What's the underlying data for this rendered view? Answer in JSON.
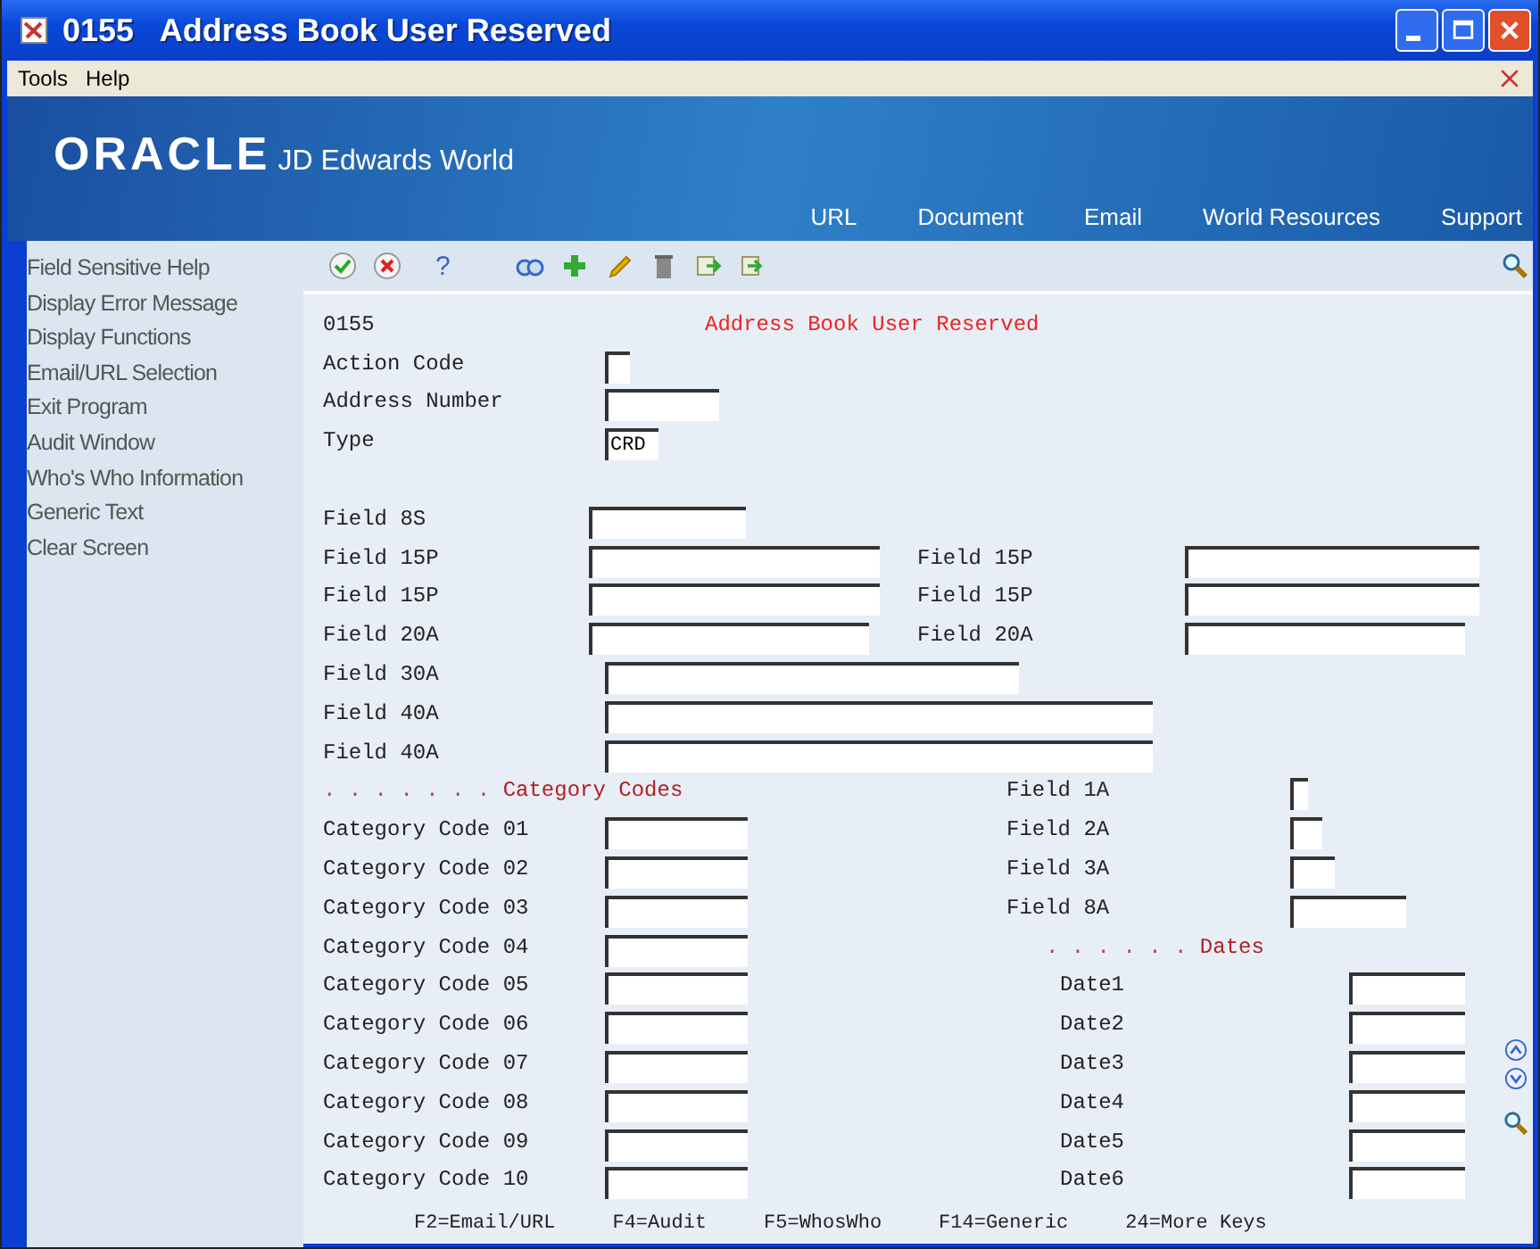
{
  "window": {
    "title": "0155   Address Book User Reserved"
  },
  "menu": [
    "Tools",
    "Help"
  ],
  "banner": {
    "logo": "ORACLE",
    "product": "JD Edwards World",
    "links": [
      "URL",
      "Document",
      "Email",
      "World Resources",
      "Support"
    ]
  },
  "toolbar": {
    "help_glyph": "?"
  },
  "sidebar": {
    "items": [
      "Field Sensitive Help",
      "Display Error Message",
      "Display Functions",
      "Email/URL Selection",
      "Exit Program",
      "Audit Window",
      "Who's Who Information",
      "Generic Text",
      "Clear Screen"
    ]
  },
  "form": {
    "program_number": "0155",
    "title": "Address Book User Reserved",
    "header_fields": [
      {
        "label": "Action Code"
      },
      {
        "label": "Address Number"
      },
      {
        "label": "Type",
        "value": "CRD"
      }
    ],
    "left_fields": [
      {
        "label": "Field 8S"
      },
      {
        "label": "Field 15P"
      },
      {
        "label": "Field 15P"
      },
      {
        "label": "Field 20A"
      },
      {
        "label": "Field 30A"
      },
      {
        "label": "Field 40A"
      },
      {
        "label": "Field 40A"
      }
    ],
    "right_fields": [
      {
        "label": "Field 15P"
      },
      {
        "label": "Field 15P"
      },
      {
        "label": "Field 20A"
      }
    ],
    "category_heading": {
      "dots": ". . . . . . .",
      "title": "Category Codes"
    },
    "category_codes": [
      {
        "label": "Category Code 01"
      },
      {
        "label": "Category Code 02"
      },
      {
        "label": "Category Code 03"
      },
      {
        "label": "Category Code 04"
      },
      {
        "label": "Category Code 05"
      },
      {
        "label": "Category Code 06"
      },
      {
        "label": "Category Code 07"
      },
      {
        "label": "Category Code 08"
      },
      {
        "label": "Category Code 09"
      },
      {
        "label": "Category Code 10"
      }
    ],
    "misc_fields": [
      {
        "label": "Field 1A"
      },
      {
        "label": "Field 2A"
      },
      {
        "label": "Field 3A"
      },
      {
        "label": "Field 8A"
      }
    ],
    "dates_heading": {
      "dots": ". . . . . .",
      "title": "Dates"
    },
    "dates": [
      {
        "label": "Date1"
      },
      {
        "label": "Date2"
      },
      {
        "label": "Date3"
      },
      {
        "label": "Date4"
      },
      {
        "label": "Date5"
      },
      {
        "label": "Date6"
      }
    ],
    "function_keys": [
      "F2=Email/URL",
      "F4=Audit",
      "F5=WhosWho",
      "F14=Generic",
      "24=More Keys"
    ]
  }
}
